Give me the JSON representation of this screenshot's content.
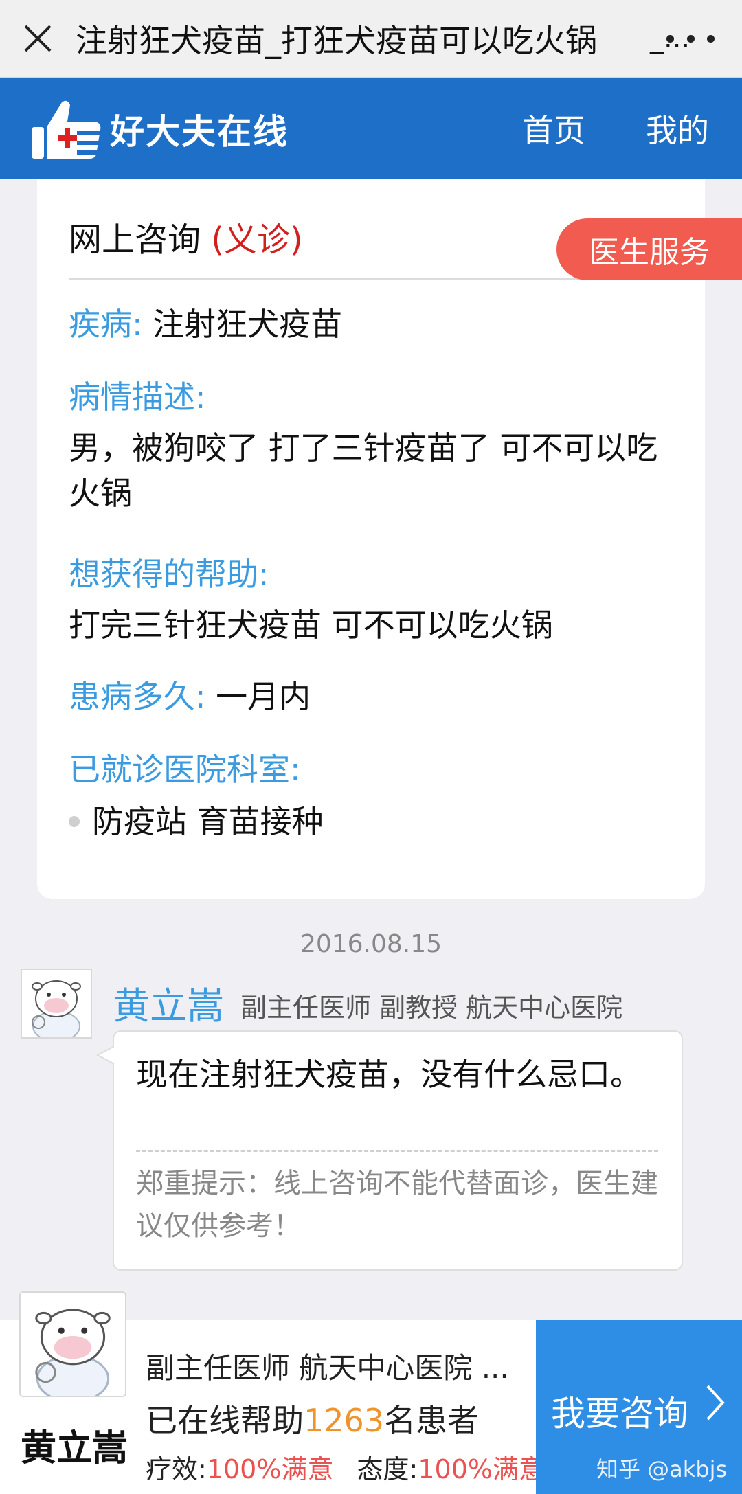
{
  "topbar": {
    "title": "注射狂犬疫苗_打狂犬疫苗可以吃火锅",
    "ellipsis": "_..."
  },
  "header": {
    "brand": "好大夫在线",
    "nav": [
      "首页",
      "我的"
    ]
  },
  "card": {
    "title": "网上咨询",
    "title_tag": "(义诊)",
    "service_badge": "医生服务",
    "fields": {
      "disease_label": "疾病:",
      "disease_value": "注射狂犬疫苗",
      "desc_label": "病情描述:",
      "desc_value": "男，被狗咬了 打了三针疫苗了 可不可以吃火锅",
      "help_label": "想获得的帮助:",
      "help_value": "打完三针狂犬疫苗 可不可以吃火锅",
      "duration_label": "患病多久:",
      "duration_value": "一月内",
      "visited_label": "已就诊医院科室:",
      "visited_value": "防疫站 育苗接种"
    }
  },
  "reply": {
    "date": "2016.08.15",
    "doctor_name": "黄立嵩",
    "doctor_title": "副主任医师 副教授 航天中心医院",
    "message": "现在注射狂犬疫苗，没有什么忌口。",
    "tip": "郑重提示：线上咨询不能代替面诊，医生建议仅供参考！"
  },
  "bottom": {
    "doctor_name": "黄立嵩",
    "line1": "副主任医师 航天中心医院 ...",
    "helped_prefix": "已在线帮助",
    "helped_count": "1263",
    "helped_suffix": "名患者",
    "effect_label": "疗效:",
    "effect_value": "100%满意",
    "attitude_label": "态度:",
    "attitude_value": "100%满意",
    "cta_label": "我要咨询",
    "watermark": "知乎 @akbjs"
  }
}
